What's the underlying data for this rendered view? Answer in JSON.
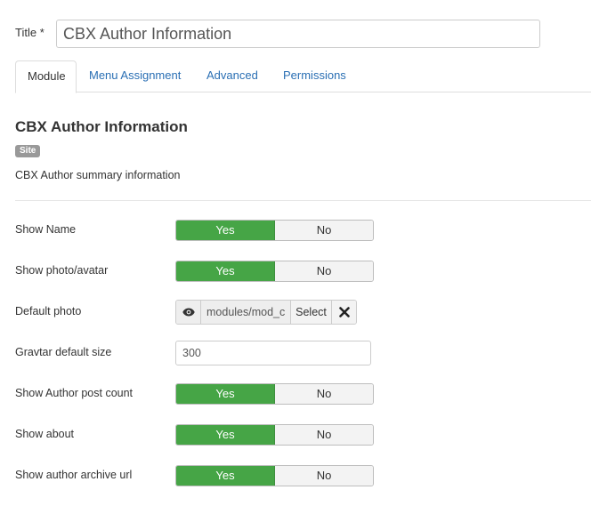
{
  "title_field": {
    "label": "Title *",
    "value": "CBX Author Information"
  },
  "tabs": [
    {
      "label": "Module",
      "active": true
    },
    {
      "label": "Menu Assignment",
      "active": false
    },
    {
      "label": "Advanced",
      "active": false
    },
    {
      "label": "Permissions",
      "active": false
    }
  ],
  "module": {
    "name": "CBX Author Information",
    "badge": "Site",
    "description": "CBX Author summary information"
  },
  "fields": {
    "show_name": {
      "label": "Show Name",
      "yes": "Yes",
      "no": "No",
      "value": "Yes"
    },
    "show_photo": {
      "label": "Show photo/avatar",
      "yes": "Yes",
      "no": "No",
      "value": "Yes"
    },
    "default_photo": {
      "label": "Default photo",
      "path": "modules/mod_c",
      "select": "Select",
      "preview_icon": "eye-icon",
      "clear_icon": "close-icon"
    },
    "gravatar_size": {
      "label": "Gravtar default size",
      "value": "300"
    },
    "show_post_count": {
      "label": "Show Author post count",
      "yes": "Yes",
      "no": "No",
      "value": "Yes"
    },
    "show_about": {
      "label": "Show about",
      "yes": "Yes",
      "no": "No",
      "value": "Yes"
    },
    "show_archive_url": {
      "label": "Show author archive url",
      "yes": "Yes",
      "no": "No",
      "value": "Yes"
    }
  },
  "colors": {
    "yes_active": "#46a546",
    "link": "#2a6fb4",
    "badge": "#999999"
  }
}
